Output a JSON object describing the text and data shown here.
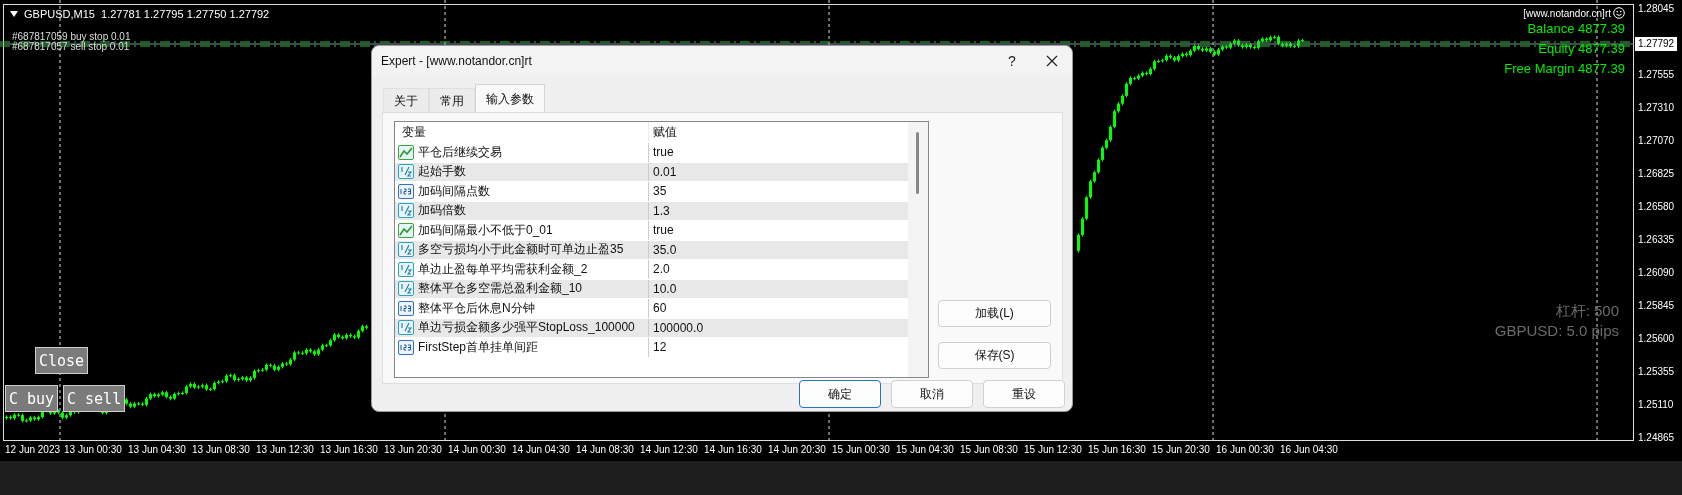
{
  "chart": {
    "header": "GBPUSD,M15  1.27781 1.27795 1.27750 1.27792",
    "order_labels": [
      "#687817059 buy stop 0.01",
      "#687817057 sell stop 0.01"
    ],
    "expert_label": "[www.notandor.cn]rt",
    "account": [
      "Balance 4877.39",
      "Equity 4877.39",
      "Free Margin 4877.39"
    ],
    "info": [
      "杠杆: 500",
      "GBPUSD: 5.0 pips"
    ],
    "buttons": [
      "Close",
      "C buy",
      "C sell"
    ],
    "price_axis": [
      "1.28045",
      "1.27555",
      "1.27310",
      "1.27070",
      "1.26825",
      "1.26580",
      "1.26335",
      "1.26090",
      "1.25845",
      "1.25600",
      "1.25355",
      "1.25110",
      "1.24865"
    ],
    "current_price": "1.27792",
    "time_axis": [
      "12 Jun 2023",
      "13 Jun 00:30",
      "13 Jun 04:30",
      "13 Jun 08:30",
      "13 Jun 12:30",
      "13 Jun 16:30",
      "13 Jun 20:30",
      "14 Jun 00:30",
      "14 Jun 04:30",
      "14 Jun 08:30",
      "14 Jun 12:30",
      "14 Jun 16:30",
      "14 Jun 20:30",
      "15 Jun 00:30",
      "15 Jun 04:30",
      "15 Jun 08:30",
      "15 Jun 12:30",
      "15 Jun 16:30",
      "15 Jun 20:30",
      "16 Jun 00:30",
      "16 Jun 04:30"
    ]
  },
  "dialog": {
    "title": "Expert - [www.notandor.cn]rt",
    "help": "?",
    "tabs": [
      {
        "label": "关于",
        "selected": false
      },
      {
        "label": "常用",
        "selected": false
      },
      {
        "label": "输入参数",
        "selected": true
      }
    ],
    "columns": [
      "变量",
      "赋值"
    ],
    "rows": [
      {
        "kind": "bool",
        "name": "平仓后继续交易",
        "value": "true"
      },
      {
        "kind": "double",
        "name": "起始手数",
        "value": "0.01"
      },
      {
        "kind": "int",
        "name": "加码间隔点数",
        "value": "35"
      },
      {
        "kind": "double",
        "name": "加码倍数",
        "value": "1.3"
      },
      {
        "kind": "bool",
        "name": "加码间隔最小不低于0_01",
        "value": "true"
      },
      {
        "kind": "double",
        "name": "多空亏损均小于此金额时可单边止盈35",
        "value": "35.0"
      },
      {
        "kind": "double",
        "name": "单边止盈每单平均需获利金额_2",
        "value": "2.0"
      },
      {
        "kind": "double",
        "name": "整体平仓多空需总盈利金额_10",
        "value": "10.0"
      },
      {
        "kind": "int",
        "name": "整体平仓后休息N分钟",
        "value": "60"
      },
      {
        "kind": "double",
        "name": "单边亏损金额多少强平StopLoss_100000",
        "value": "100000.0"
      },
      {
        "kind": "int",
        "name": "FirstStep首单挂单间距",
        "value": "12"
      }
    ],
    "side_buttons": [
      "加载(L)",
      "保存(S)"
    ],
    "buttons": [
      {
        "label": "确定",
        "default": true
      },
      {
        "label": "取消",
        "default": false
      },
      {
        "label": "重设",
        "default": false
      }
    ]
  }
}
